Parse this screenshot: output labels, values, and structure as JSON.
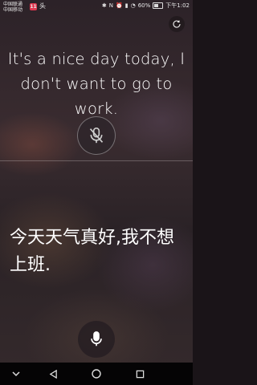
{
  "status_bar": {
    "carrier_line1": "中国联通",
    "carrier_line2": "中国移动",
    "notif_badge": "11",
    "notif_app": "头",
    "battery": "60%",
    "time": "下午1:02"
  },
  "translation": {
    "source_text": "It's a nice day today, I don't want to go to work.",
    "target_text": "今天天气真好,我不想上班."
  },
  "controls": {
    "rotate_icon": "rotate-icon",
    "muted_mic_icon": "mic-off-icon",
    "mic_icon": "mic-icon"
  },
  "nav": {
    "items": [
      "chevron-down-icon",
      "back-icon",
      "home-icon",
      "recents-icon"
    ]
  },
  "colors": {
    "accent": "#ffffff",
    "background": "#2c2228"
  }
}
